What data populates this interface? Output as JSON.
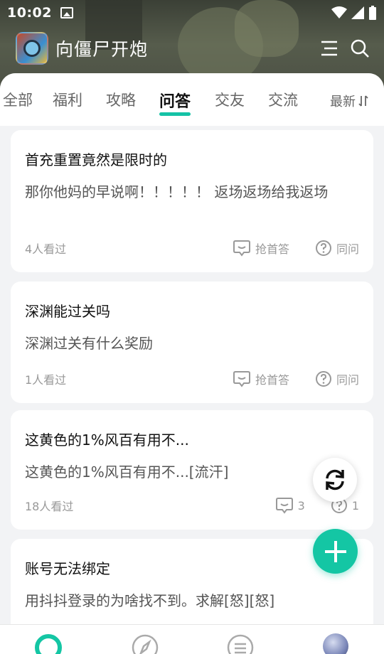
{
  "status_bar": {
    "time": "10:02"
  },
  "app": {
    "title": "向僵尸开炮"
  },
  "tabs": [
    {
      "label": "全部"
    },
    {
      "label": "福利"
    },
    {
      "label": "攻略"
    },
    {
      "label": "问答"
    },
    {
      "label": "交友"
    },
    {
      "label": "交流"
    }
  ],
  "active_tab": "问答",
  "sort": {
    "label": "最新"
  },
  "posts": [
    {
      "question": "首充重置竟然是限时的",
      "detail": "那你他妈的早说啊！！！！！ 返场返场给我返场",
      "views": "4人看过",
      "answer_action": "抢首答",
      "same_question": "同问"
    },
    {
      "question": "深渊能过关吗",
      "detail": "深渊过关有什么奖励",
      "views": "1人看过",
      "answer_action": "抢首答",
      "same_question": "同问"
    },
    {
      "question": "这黄色的1%风百有用不...",
      "detail": "这黄色的1%风百有用不...[流汗]",
      "views": "18人看过",
      "answer_count": "3",
      "same_count": "1"
    },
    {
      "question": "账号无法绑定",
      "detail": "用抖抖登录的为啥找不到。求解[怒][怒]"
    }
  ],
  "colors": {
    "accent": "#14c6a4",
    "background": "#f2f3f5",
    "card": "#ffffff"
  }
}
